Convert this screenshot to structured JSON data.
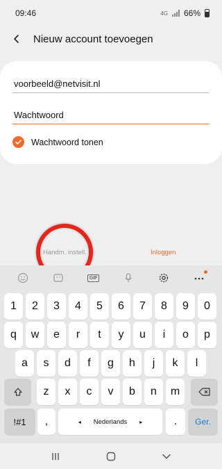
{
  "status_bar": {
    "time": "09:46",
    "network_label": "4G",
    "battery": "66%"
  },
  "header": {
    "title": "Nieuw account toevoegen",
    "back_icon": "chevron-left-icon"
  },
  "form": {
    "email_value": "voorbeeld@netvisit.nl",
    "password_placeholder": "Wachtwoord",
    "show_password_label": "Wachtwoord tonen",
    "show_password_checked": true,
    "accent_color": "#f06a2c"
  },
  "actions": {
    "manual_setup_label": "Handm. instell.",
    "login_label": "Inloggen"
  },
  "keyboard": {
    "toolbar": {
      "gif_label": "GIF",
      "icons": [
        "smiley-icon",
        "sticker-icon",
        "gif-icon",
        "microphone-icon",
        "gear-icon",
        "more-icon"
      ]
    },
    "row_numbers": [
      "1",
      "2",
      "3",
      "4",
      "5",
      "6",
      "7",
      "8",
      "9",
      "0"
    ],
    "row_top": [
      "q",
      "w",
      "e",
      "r",
      "t",
      "y",
      "u",
      "i",
      "o",
      "p"
    ],
    "row_middle": [
      "a",
      "s",
      "d",
      "f",
      "g",
      "h",
      "j",
      "k",
      "l"
    ],
    "row_bottom": [
      "z",
      "x",
      "c",
      "v",
      "b",
      "n",
      "m"
    ],
    "symbols_label": "!#1",
    "comma_label": ",",
    "space_label": "Nederlands",
    "space_left_arrow": "◂",
    "space_right_arrow": "▸",
    "period_label": ".",
    "enter_label": "Ger."
  }
}
